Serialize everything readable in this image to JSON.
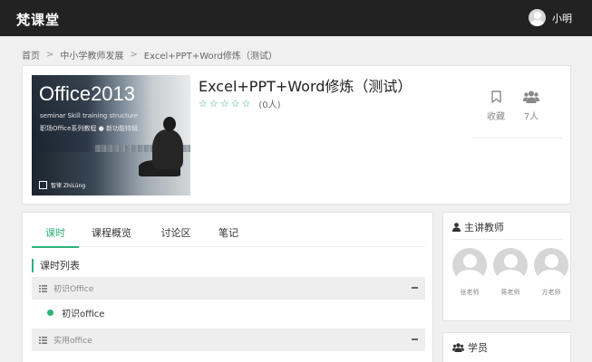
{
  "brand": "梵课堂",
  "user": {
    "name": "小明"
  },
  "breadcrumb": [
    "首页",
    "中小学教师发展",
    "Excel+PPT+Word修炼（测试）"
  ],
  "course": {
    "title": "Excel+PPT+Word修炼（测试）",
    "rating": 0,
    "rating_count": "(0人)",
    "favorite_label": "收藏",
    "people_label": "7人",
    "cover": {
      "title": "Office2013",
      "subtitle1": "seminar  Skill training structure",
      "subtitle2": "职场Office系列教程  ●  新功能特辑",
      "brand": "智律 ZhiLüng"
    }
  },
  "tabs": [
    "课时",
    "课程概览",
    "讨论区",
    "笔记"
  ],
  "lesson_list": {
    "title": "课时列表",
    "chapters": [
      {
        "label": "初识Office",
        "lessons": [
          "初识office"
        ]
      },
      {
        "label": "实用office",
        "lessons": []
      }
    ]
  },
  "teachers": {
    "title": "主讲教师",
    "list": [
      "张老师",
      "蒋老师",
      "方老师"
    ]
  },
  "students": {
    "title": "学员"
  },
  "colors": {
    "accent": "#2fb37a",
    "topbar": "#222222"
  },
  "icons": {
    "favorite": "bookmark-icon",
    "people": "users-icon",
    "teacher": "user-icon",
    "student": "users-icon",
    "chapter": "list-icon",
    "collapse": "minus-icon"
  }
}
